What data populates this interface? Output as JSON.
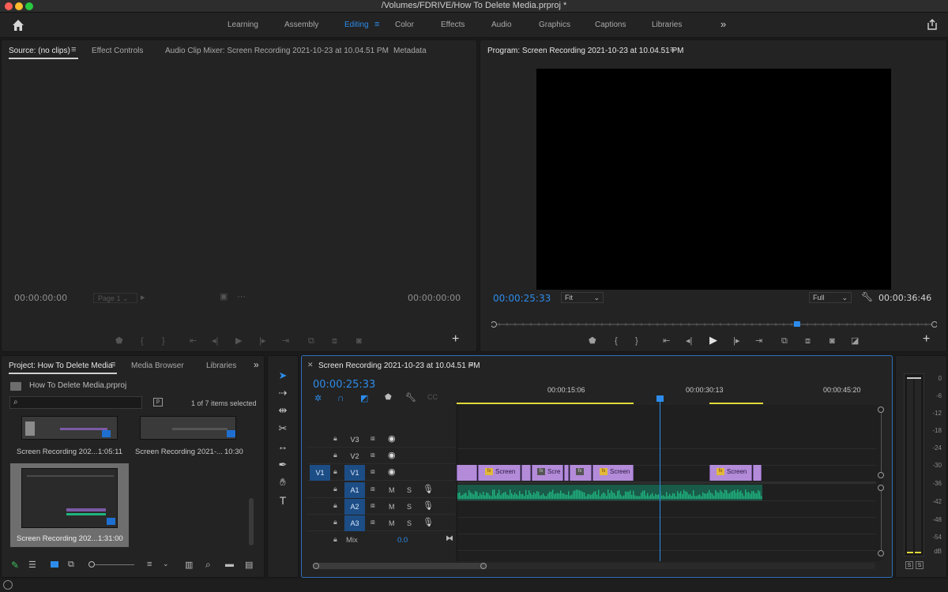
{
  "window": {
    "title": "/Volumes/FDRIVE/How To Delete Media.prproj *",
    "traffic_colors": [
      "#ff5f57",
      "#febc2e",
      "#28c840"
    ]
  },
  "workspaces": {
    "tabs": [
      "Learning",
      "Assembly",
      "Editing",
      "Color",
      "Effects",
      "Audio",
      "Graphics",
      "Captions",
      "Libraries"
    ],
    "active": "Editing",
    "overflow_icon": "chevrons-right-icon"
  },
  "source_panel": {
    "tabs": [
      "Source: (no clips)",
      "Effect Controls",
      "Audio Clip Mixer: Screen Recording 2021-10-23 at 10.04.51 PM",
      "Metadata"
    ],
    "timecode_in": "00:00:00:00",
    "page_label": "Page 1",
    "timecode_out": "00:00:00:00"
  },
  "program_panel": {
    "title": "Program: Screen Recording 2021-10-23 at 10.04.51 PM",
    "timecode": "00:00:25:33",
    "fit": "Fit",
    "quality": "Full",
    "duration": "00:00:36:46",
    "playhead_fraction": 0.69
  },
  "project_panel": {
    "tabs": [
      "Project: How To Delete Media",
      "Media Browser",
      "Libraries"
    ],
    "project_file": "How To Delete Media.prproj",
    "search_placeholder": "",
    "selection_status": "1 of 7 items selected",
    "items": [
      {
        "name": "Screen Recording 202...",
        "duration": "1:05:11"
      },
      {
        "name": "Screen Recording 2021-...",
        "duration": "10:30"
      },
      {
        "name": "Screen Recording 202...",
        "duration": "1:31:00"
      }
    ]
  },
  "timeline": {
    "sequence_name": "Screen Recording 2021-10-23 at 10.04.51 PM",
    "timecode": "00:00:25:33",
    "ruler_labels": [
      "00:00:15:06",
      "00:00:30:13",
      "00:00:45:20"
    ],
    "tracks": {
      "video": [
        "V3",
        "V2",
        "V1"
      ],
      "audio": [
        "A1",
        "A2",
        "A3"
      ],
      "source_patch_video": "V1",
      "mute": "M",
      "solo": "S",
      "mix_label": "Mix",
      "mix_value": "0.0"
    },
    "clip_labels": [
      "Screen",
      "Scre",
      "Screen",
      "Screen"
    ]
  },
  "audio_meter": {
    "labels": [
      "0",
      "-6",
      "-12",
      "-18",
      "-24",
      "-30",
      "-36",
      "-42",
      "-48",
      "-54",
      "dB"
    ],
    "solo_buttons": [
      "S",
      "S"
    ]
  },
  "colors": {
    "accent": "#2d8ceb",
    "clip_video": "#b38bd9",
    "clip_audio": "#1fb37f",
    "in_out_bar": "#e0d83a"
  }
}
